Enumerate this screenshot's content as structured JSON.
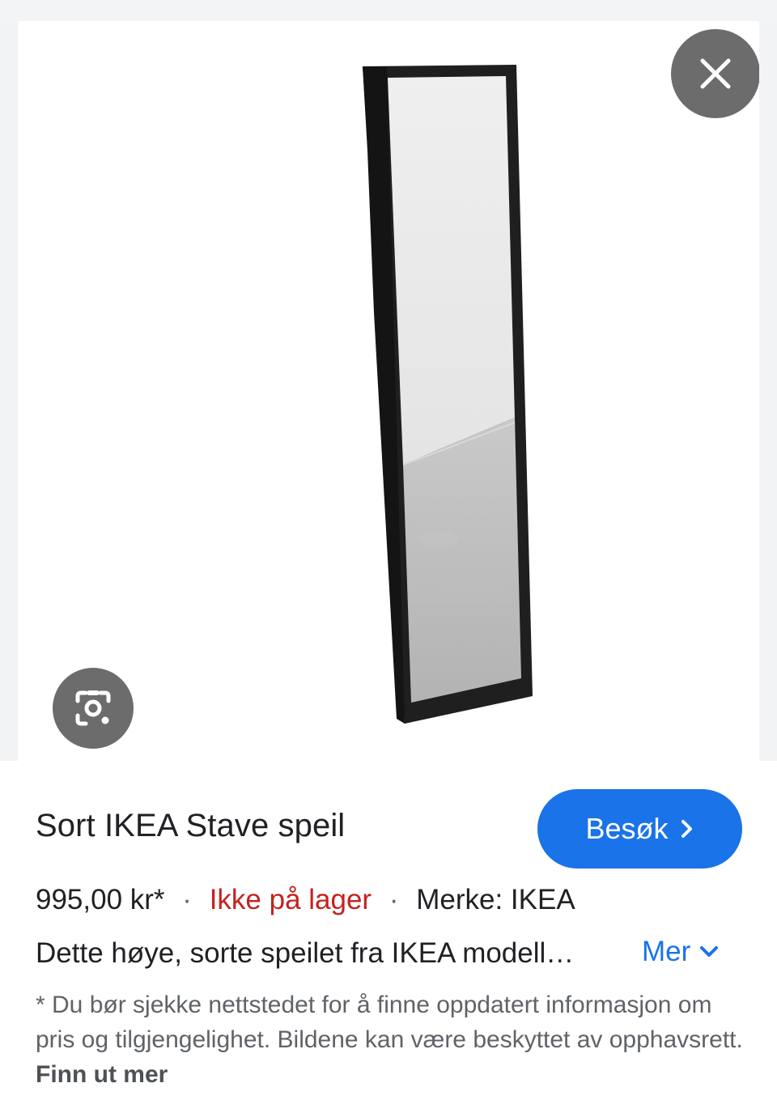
{
  "product": {
    "title": "Sort IKEA Stave speil",
    "price": "995,00 kr*",
    "separator": "·",
    "stock_status": "Ikke på lager",
    "brand": "Merke: IKEA",
    "description": "Dette høye, sorte speilet fra IKEA modell…"
  },
  "actions": {
    "visit_label": "Besøk",
    "more_label": "Mer"
  },
  "disclaimer": {
    "text": "* Du bør sjekke nettstedet for å finne oppdatert informasjon om pris og tilgjengelighet. Bildene kan være beskyttet av opphavsrett. ",
    "link_label": "Finn ut mer"
  },
  "icons": {
    "close": "close-icon",
    "lens": "lens-search-icon",
    "visit_chevron": "chevron-right-icon",
    "more_chevron": "chevron-down-icon"
  },
  "colors": {
    "accent": "#1a73e8",
    "stock_status": "#c5221f",
    "overlay_button": "#5f5f5f",
    "text_primary": "#202124",
    "text_secondary": "#5f6368"
  }
}
